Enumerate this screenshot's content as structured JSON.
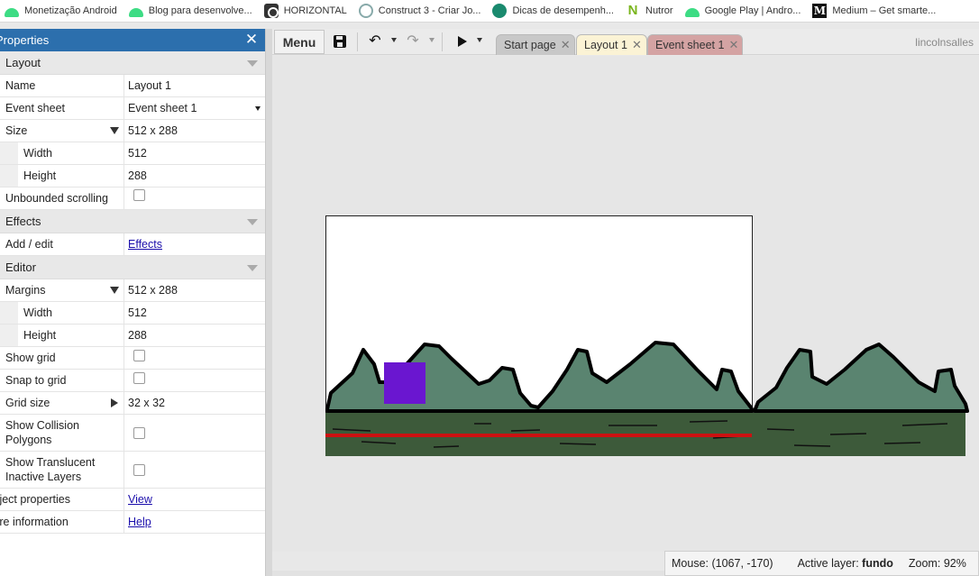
{
  "bookmarks": [
    {
      "label": "Monetização Android",
      "icon": "android-icon"
    },
    {
      "label": "Blog para desenvolve...",
      "icon": "android-icon"
    },
    {
      "label": "HORIZONTAL",
      "icon": "horizontal-icon"
    },
    {
      "label": "Construct 3 - Criar Jo...",
      "icon": "construct-icon"
    },
    {
      "label": "Dicas de desempenh...",
      "icon": "speed-icon"
    },
    {
      "label": "Nutror",
      "icon": "nutror-icon"
    },
    {
      "label": "Google Play   |   Andro...",
      "icon": "android-icon"
    },
    {
      "label": "Medium – Get smarte...",
      "icon": "medium-icon"
    }
  ],
  "panel": {
    "title": "Properties",
    "sections": {
      "layout": "Layout",
      "effects": "Effects",
      "editor": "Editor"
    },
    "rows": {
      "name": {
        "label": "Name",
        "value": "Layout 1"
      },
      "event_sheet": {
        "label": "Event sheet",
        "value": "Event sheet 1"
      },
      "size": {
        "label": "Size",
        "value": "512 x 288"
      },
      "width": {
        "label": "Width",
        "value": "512"
      },
      "height": {
        "label": "Height",
        "value": "288"
      },
      "unbounded": {
        "label": "Unbounded scrolling",
        "checked": false
      },
      "add_edit": {
        "label": "Add / edit",
        "value": "Effects"
      },
      "margins": {
        "label": "Margins",
        "value": "512 x 288"
      },
      "margins_width": {
        "label": "Width",
        "value": "512"
      },
      "margins_height": {
        "label": "Height",
        "value": "288"
      },
      "show_grid": {
        "label": "Show grid",
        "checked": false
      },
      "snap_grid": {
        "label": "Snap to grid",
        "checked": false
      },
      "grid_size": {
        "label": "Grid size",
        "value": "32 x 32"
      },
      "collision": {
        "label_1": "Show Collision",
        "label_2": "Polygons",
        "checked": false
      },
      "translucent": {
        "label_1": "Show Translucent",
        "label_2": "Inactive Layers",
        "checked": false
      },
      "project_props": {
        "label": "Project properties",
        "value": "View"
      },
      "more_info": {
        "label": "More information",
        "value": "Help"
      }
    }
  },
  "toolbar": {
    "menu_label": "Menu",
    "tabs": [
      {
        "label": "Start page"
      },
      {
        "label": "Layout 1",
        "active": true
      },
      {
        "label": "Event sheet 1"
      }
    ],
    "user": "lincolnsalles"
  },
  "status": {
    "mouse_label": "Mouse:",
    "mouse_value": "(1067, -170)",
    "layer_label": "Active layer:",
    "layer_value": "fundo",
    "zoom_label": "Zoom:",
    "zoom_value": "92%"
  },
  "colors": {
    "panel_header": "#2c6fad",
    "hills": "#5a8470",
    "ground": "#3d5a3a",
    "sprite": "#6a16d0",
    "red_line": "#cc1111"
  }
}
